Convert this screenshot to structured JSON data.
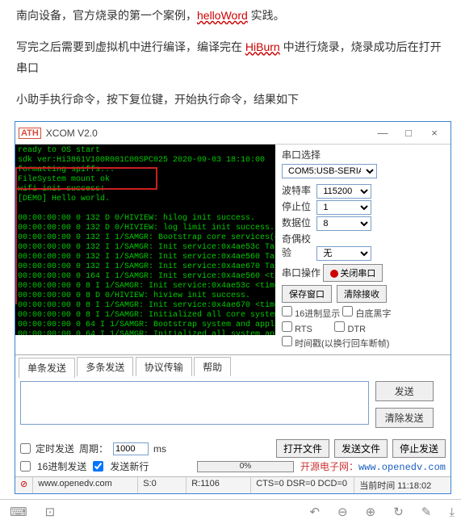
{
  "doc": {
    "p1_a": "南向设备，官方烧录的第一个案例，",
    "p1_b": "helloWord",
    "p1_c": " 实践。",
    "p2_a": "写完之后需要到虚拟机中进行编译，编译完在 ",
    "p2_b": "HiBurn",
    "p2_c": " 中进行烧录，烧录成功后在打开串口",
    "p3": "小助手执行命令，按下复位键，开始执行命令，结果如下"
  },
  "app": {
    "title": "XCOM V2.0",
    "min": "—",
    "max": "□",
    "close": "×"
  },
  "terminal_lines": "ready to OS start\nsdk ver:Hi3861V100R001C00SPC025 2020-09-03 18:10:00\nformatting spiffs...\nFileSystem mount ok\nwifi init success!\n[DEMO] Hello world.\n\n00:00:00:00 0 132 D 0/HIVIEW: hilog init success.\n00:00:00:00 0 132 D 0/HIVIEW: log limit init success.\n00:00:00:00 0 132 I 1/SAMGR: Bootstrap core services(count:3).\n00:00:00:00 0 132 I 1/SAMGR: Init service:0x4ae53c TaskPool:0xfa1e4\n00:00:00:00 0 132 I 1/SAMGR: Init service:0x4ae560 TaskPool:0xfa854\n00:00:00:00 0 132 I 1/SAMGR: Init service:0x4ae670 TaskPool:0xfaa14\n00:00:00:00 0 164 I 1/SAMGR: Init service:0x4ae560 <time: 0ms> success!\n00:00:00:00 0 8 I 1/SAMGR: Init service:0x4ae53c <time: 0ms> success!\n00:00:00:00 0 8 D 0/HIVIEW: hiview init success.\n00:00:00:00 0 8 I 1/SAMGR: Init service:0x4ae670 <time: 0ms> success!\n00:00:00:00 0 8 I 1/SAMGR: Initialized all core system services!\n00:00:00:00 0 64 I 1/SAMGR: Bootstrap system and application services(count:0).\n00:00:00:00 0 64 I 1/SAMGR: Initialized all system and application services!\n00:00:00:00 0 64 I 1/SAMGR: Bootstrap dynamic registered services(count:0).",
  "side": {
    "port_label": "串口选择",
    "port_value": "COM5:USB-SERIAL",
    "baud_label": "波特率",
    "baud_value": "115200",
    "stop_label": "停止位",
    "stop_value": "1",
    "data_label": "数据位",
    "data_value": "8",
    "parity_label": "奇偶校验",
    "parity_value": "无",
    "op_label": "串口操作",
    "op_btn": "关闭串口",
    "save_btn": "保存窗口",
    "clear_btn": "清除接收",
    "hex_disp": "16进制显示",
    "white_bg": "白底黑字",
    "rts": "RTS",
    "dtr": "DTR",
    "timestamp": "时间戳(以换行回车断帧)"
  },
  "tabs": {
    "t1": "单条发送",
    "t2": "多条发送",
    "t3": "协议传输",
    "t4": "帮助"
  },
  "send": {
    "send_btn": "发送",
    "clear_btn": "清除发送"
  },
  "bot": {
    "timed": "定时发送",
    "period_label": "周期：",
    "period_value": "1000",
    "ms": "ms",
    "open_file": "打开文件",
    "send_file": "发送文件",
    "stop_send": "停止发送",
    "hex_send": "16进制发送",
    "send_newline": "发送新行",
    "link_label": "开源电子网：",
    "link_url": "www.openedv.com"
  },
  "status": {
    "url": "www.openedv.com",
    "s": "S:0",
    "r": "R:1106",
    "cts": "CTS=0 DSR=0 DCD=0",
    "time": "当前时间 11:18:02"
  }
}
